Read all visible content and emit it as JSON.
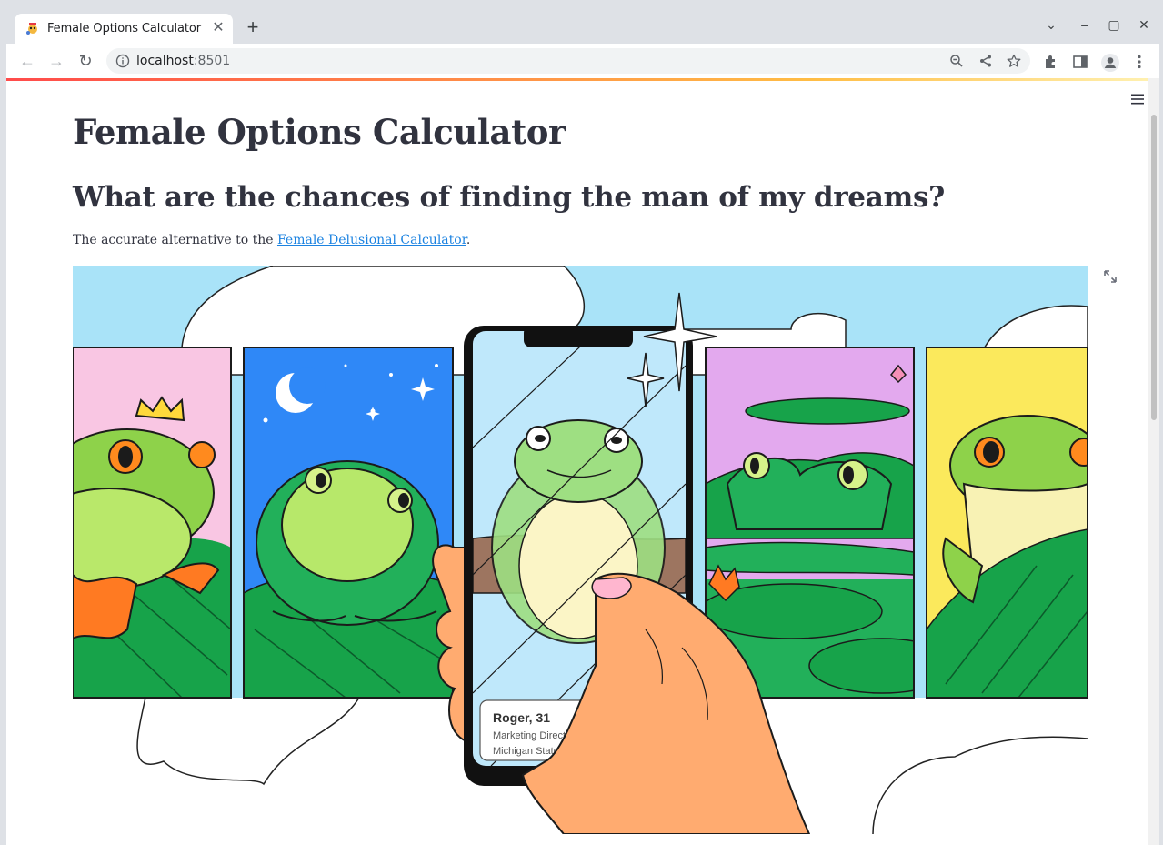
{
  "browser": {
    "tab_title": "Female Options Calculator",
    "url_host": "localhost",
    "url_port": ":8501"
  },
  "page": {
    "title": "Female Options Calculator",
    "subtitle": "What are the chances of finding the man of my dreams?",
    "intro_prefix": "The accurate alternative to the ",
    "intro_link": "Female Delusional Calculator",
    "intro_suffix": "."
  },
  "hero_image": {
    "profile_name": "Roger, 31",
    "profile_job": "Marketing Director",
    "profile_school": "Michigan State University, 2010",
    "panel_colors": [
      "#f9c6e3",
      "#2f88f7",
      "#a9e3f8",
      "#e3a9ee",
      "#fbe95c"
    ],
    "sky_color": "#a9e3f8",
    "frog_color": "#22b05a"
  },
  "colors": {
    "accent_gradient_start": "#ff4b4b",
    "link": "#1c83e1",
    "text": "#31333f"
  }
}
